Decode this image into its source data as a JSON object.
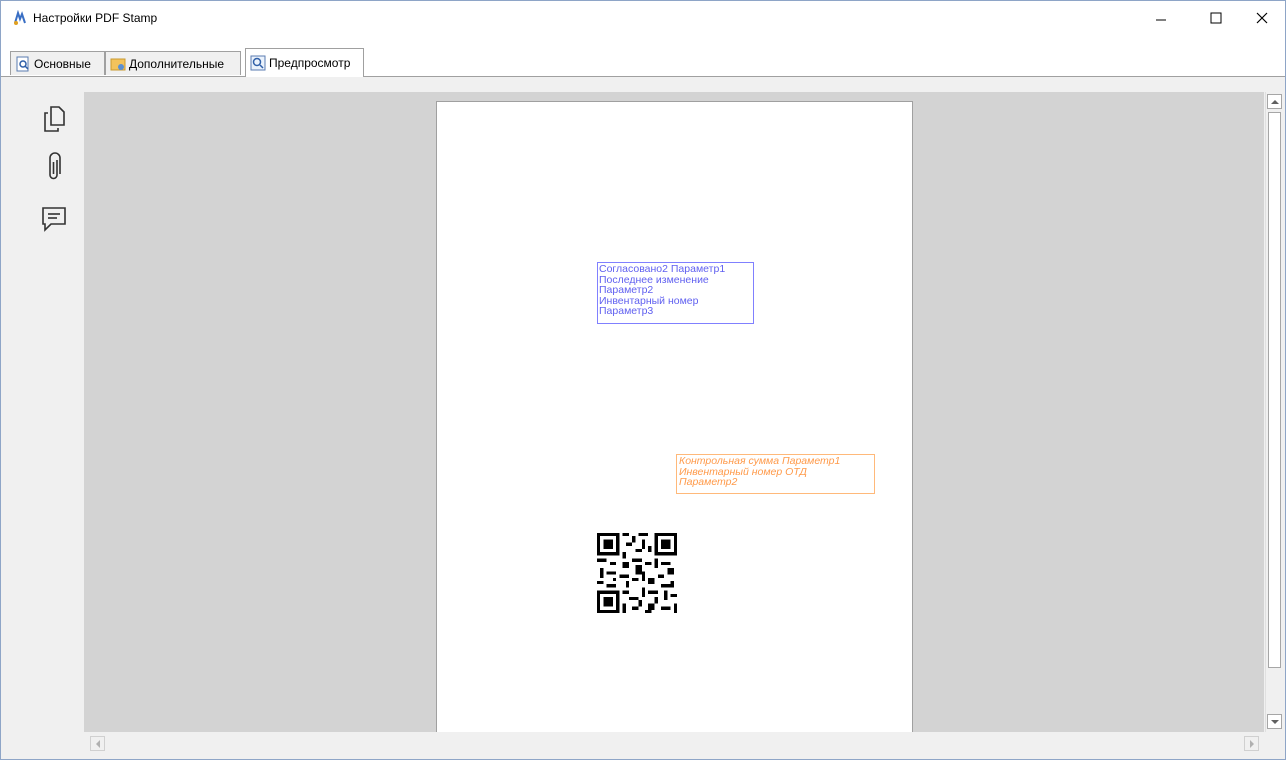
{
  "window": {
    "title": "Настройки PDF Stamp"
  },
  "tabs": [
    {
      "label": "Основные"
    },
    {
      "label": "Дополнительные"
    },
    {
      "label": "Предпросмотр"
    }
  ],
  "active_tab": "Предпросмотр",
  "sidebar": {
    "tools": [
      "pages-icon",
      "attachment-icon",
      "comment-icon"
    ]
  },
  "preview": {
    "stamp_blue": {
      "color": "#6060f0",
      "lines": [
        "Согласовано2 Параметр1",
        "Последнее изменение",
        "Параметр2",
        "Инвентарный номер",
        "Параметр3"
      ]
    },
    "stamp_orange": {
      "color": "#ff9a4a",
      "lines": [
        "Контрольная сумма Параметр1",
        "Инвентарный номер ОТД",
        "Параметр2"
      ]
    }
  }
}
